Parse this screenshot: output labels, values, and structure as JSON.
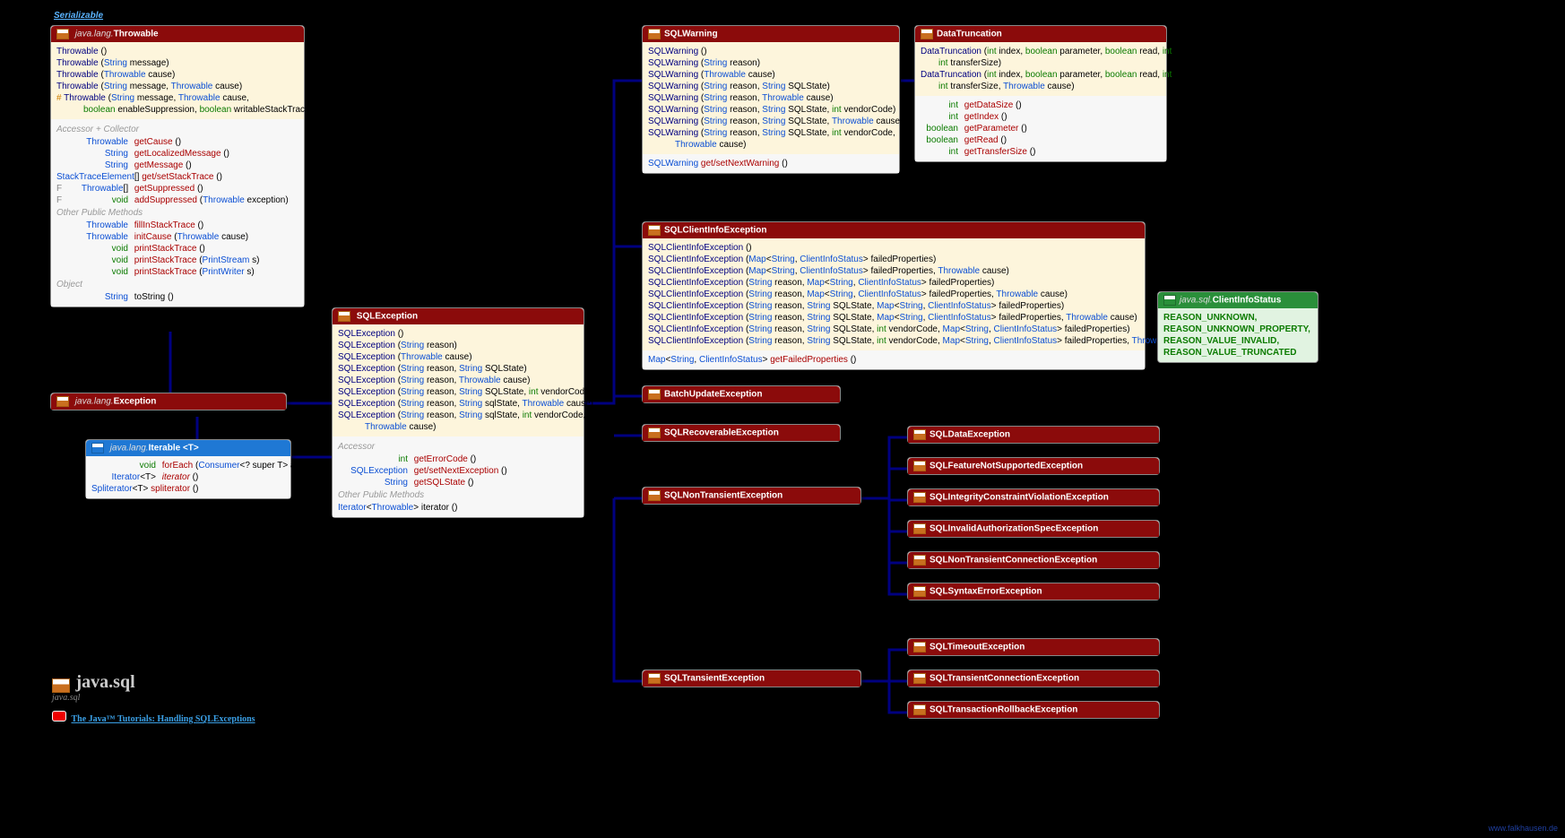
{
  "links": {
    "serializable": "Serializable",
    "tutorial": "The Java™ Tutorials: Handling SQLExceptions",
    "watermark": "www.falkhausen.de"
  },
  "package": {
    "title": "java.sql",
    "sub": "java.sql"
  },
  "throwable": {
    "pkg": "java.lang.",
    "name": "Throwable",
    "ctors": [
      {
        "name": "Throwable",
        "params": "()"
      },
      {
        "name": "Throwable",
        "params": "(String message)"
      },
      {
        "name": "Throwable",
        "params": "(Throwable cause)"
      },
      {
        "name": "Throwable",
        "params": "(String message, Throwable cause)"
      },
      {
        "prefix": "#",
        "name": "Throwable",
        "params": "(String message, Throwable cause,",
        "params2": "boolean enableSuppression, boolean writableStackTrace)"
      }
    ],
    "acc_label": "Accessor + Collector",
    "accessors": [
      {
        "ret": "Throwable",
        "name": "getCause",
        "params": "()"
      },
      {
        "ret": "String",
        "name": "getLocalizedMessage",
        "params": "()"
      },
      {
        "ret": "String",
        "name": "getMessage",
        "params": "()"
      },
      {
        "ret": "StackTraceElement[]",
        "name": "get/setStackTrace",
        "params": "()"
      },
      {
        "prefix": "F",
        "ret": "Throwable[]",
        "name": "getSuppressed",
        "params": "()"
      },
      {
        "prefix": "F",
        "ret": "void",
        "name": "addSuppressed",
        "params": "(Throwable exception)"
      }
    ],
    "opm_label": "Other Public Methods",
    "opm": [
      {
        "ret": "Throwable",
        "name": "fillInStackTrace",
        "params": "()"
      },
      {
        "ret": "Throwable",
        "name": "initCause",
        "params": "(Throwable cause)"
      },
      {
        "ret": "void",
        "name": "printStackTrace",
        "params": "()"
      },
      {
        "ret": "void",
        "name": "printStackTrace",
        "params": "(PrintStream s)"
      },
      {
        "ret": "void",
        "name": "printStackTrace",
        "params": "(PrintWriter s)"
      }
    ],
    "obj_label": "Object",
    "obj": [
      {
        "ret": "String",
        "name": "toString",
        "params": "()"
      }
    ]
  },
  "exception": {
    "pkg": "java.lang.",
    "name": "Exception"
  },
  "iterable": {
    "pkg": "java.lang.",
    "name": "Iterable",
    "generic": "<T>",
    "methods": [
      {
        "ret": "void",
        "name": "forEach",
        "params": "(Consumer<? super T> action)"
      },
      {
        "ret": "Iterator<T>",
        "name": "iterator",
        "params": "()"
      },
      {
        "ret": "Spliterator<T>",
        "name": "spliterator",
        "params": "()"
      }
    ]
  },
  "sqlex": {
    "name": "SQLException",
    "ctors": [
      {
        "name": "SQLException",
        "params": "()"
      },
      {
        "name": "SQLException",
        "params": "(String reason)"
      },
      {
        "name": "SQLException",
        "params": "(Throwable cause)"
      },
      {
        "name": "SQLException",
        "params": "(String reason, String SQLState)"
      },
      {
        "name": "SQLException",
        "params": "(String reason, Throwable cause)"
      },
      {
        "name": "SQLException",
        "params": "(String reason, String SQLState, int vendorCode)"
      },
      {
        "name": "SQLException",
        "params": "(String reason, String sqlState, Throwable cause)"
      },
      {
        "name": "SQLException",
        "params": "(String reason, String sqlState, int vendorCode,",
        "params2": "Throwable cause)"
      }
    ],
    "acc_label": "Accessor",
    "acc": [
      {
        "ret": "int",
        "name": "getErrorCode",
        "params": "()"
      },
      {
        "ret": "SQLException",
        "name": "get/setNextException",
        "params": "()"
      },
      {
        "ret": "String",
        "name": "getSQLState",
        "params": "()"
      }
    ],
    "opm_label": "Other Public Methods",
    "opm": [
      {
        "ret": "Iterator<Throwable>",
        "name": "iterator",
        "params": "()"
      }
    ]
  },
  "sqlwarn": {
    "name": "SQLWarning",
    "ctors": [
      {
        "name": "SQLWarning",
        "params": "()"
      },
      {
        "name": "SQLWarning",
        "params": "(String reason)"
      },
      {
        "name": "SQLWarning",
        "params": "(Throwable cause)"
      },
      {
        "name": "SQLWarning",
        "params": "(String reason, String SQLState)"
      },
      {
        "name": "SQLWarning",
        "params": "(String reason, Throwable cause)"
      },
      {
        "name": "SQLWarning",
        "params": "(String reason, String SQLState, int vendorCode)"
      },
      {
        "name": "SQLWarning",
        "params": "(String reason, String SQLState, Throwable cause)"
      },
      {
        "name": "SQLWarning",
        "params": "(String reason, String SQLState, int vendorCode,",
        "params2": "Throwable cause)"
      }
    ],
    "acc": [
      {
        "ret": "SQLWarning",
        "name": "get/setNextWarning",
        "params": "()"
      }
    ]
  },
  "datatrunc": {
    "name": "DataTruncation",
    "ctors": [
      {
        "name": "DataTruncation",
        "params": "(int index, boolean parameter, boolean read, int dataSize,",
        "params2": "int transferSize)"
      },
      {
        "name": "DataTruncation",
        "params": "(int index, boolean parameter, boolean read, int dataSize,",
        "params2": "int transferSize, Throwable cause)"
      }
    ],
    "acc": [
      {
        "ret": "int",
        "name": "getDataSize",
        "params": "()"
      },
      {
        "ret": "int",
        "name": "getIndex",
        "params": "()"
      },
      {
        "ret": "boolean",
        "name": "getParameter",
        "params": "()"
      },
      {
        "ret": "boolean",
        "name": "getRead",
        "params": "()"
      },
      {
        "ret": "int",
        "name": "getTransferSize",
        "params": "()"
      }
    ]
  },
  "sqlclient": {
    "name": "SQLClientInfoException",
    "ctors": [
      {
        "name": "SQLClientInfoException",
        "params": "()"
      },
      {
        "name": "SQLClientInfoException",
        "params": "(Map<String, ClientInfoStatus> failedProperties)"
      },
      {
        "name": "SQLClientInfoException",
        "params": "(Map<String, ClientInfoStatus> failedProperties, Throwable cause)"
      },
      {
        "name": "SQLClientInfoException",
        "params": "(String reason, Map<String, ClientInfoStatus> failedProperties)"
      },
      {
        "name": "SQLClientInfoException",
        "params": "(String reason, Map<String, ClientInfoStatus> failedProperties, Throwable cause)"
      },
      {
        "name": "SQLClientInfoException",
        "params": "(String reason, String SQLState, Map<String, ClientInfoStatus> failedProperties)"
      },
      {
        "name": "SQLClientInfoException",
        "params": "(String reason, String SQLState, Map<String, ClientInfoStatus> failedProperties, Throwable cause)"
      },
      {
        "name": "SQLClientInfoException",
        "params": "(String reason, String SQLState, int vendorCode, Map<String, ClientInfoStatus> failedProperties)"
      },
      {
        "name": "SQLClientInfoException",
        "params": "(String reason, String SQLState, int vendorCode, Map<String, ClientInfoStatus> failedProperties, Throwable cause)"
      }
    ],
    "acc": [
      {
        "ret": "Map<String, ClientInfoStatus>",
        "name": "getFailedProperties",
        "params": "()"
      }
    ]
  },
  "clientinfo": {
    "pkg": "java.sql.",
    "name": "ClientInfoStatus",
    "values": [
      "REASON_UNKNOWN,",
      "REASON_UNKNOWN_PROPERTY,",
      "REASON_VALUE_INVALID,",
      "REASON_VALUE_TRUNCATED"
    ]
  },
  "simple": {
    "batch": "BatchUpdateException",
    "recov": "SQLRecoverableException",
    "nontrans": "SQLNonTransientException",
    "trans": "SQLTransientException",
    "data": "SQLDataException",
    "feat": "SQLFeatureNotSupportedException",
    "integ": "SQLIntegrityConstraintViolationException",
    "auth": "SQLInvalidAuthorizationSpecException",
    "ntconn": "SQLNonTransientConnectionException",
    "syntax": "SQLSyntaxErrorException",
    "timeout": "SQLTimeoutException",
    "tconn": "SQLTransientConnectionException",
    "rollback": "SQLTransactionRollbackException"
  }
}
